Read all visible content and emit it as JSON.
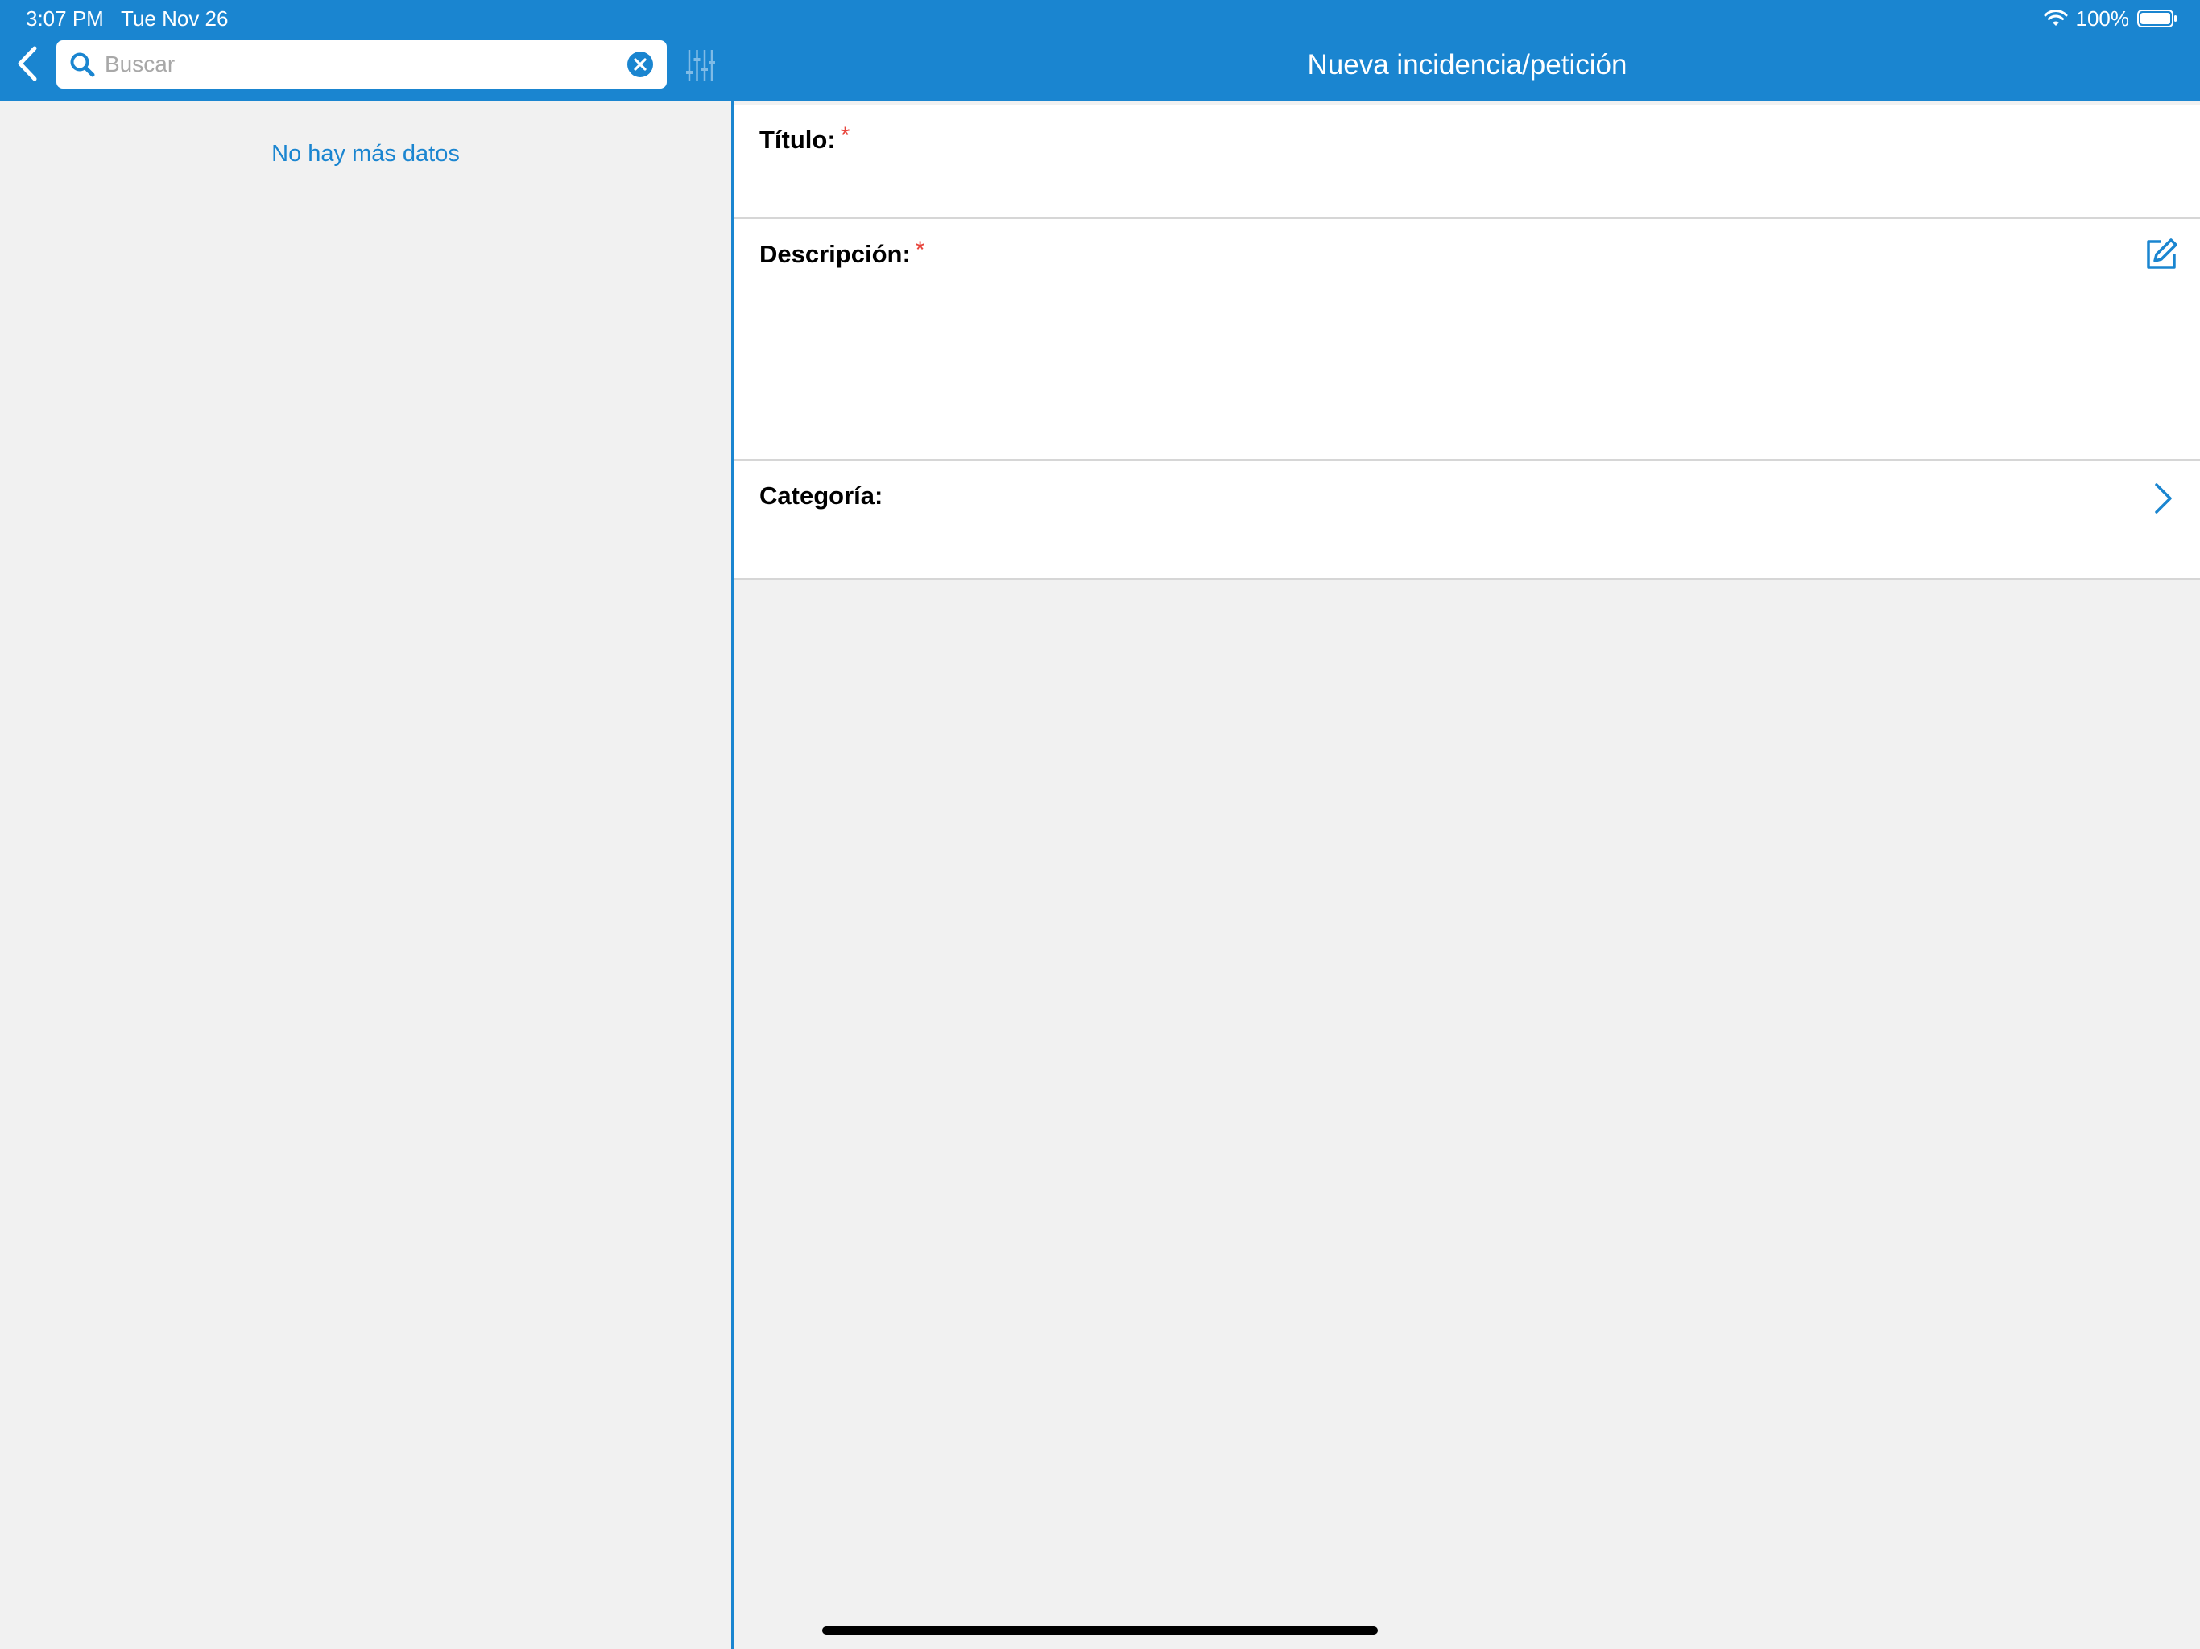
{
  "status_bar": {
    "time": "3:07 PM",
    "date": "Tue Nov 26",
    "battery_percent": "100%",
    "wifi_icon": "wifi-icon",
    "battery_icon": "battery-full-icon"
  },
  "nav": {
    "title": "Nueva incidencia/petición",
    "back_icon": "chevron-left-icon",
    "filter_icon": "sliders-icon"
  },
  "search": {
    "placeholder": "Buscar",
    "value": "",
    "search_icon": "magnifier-icon",
    "clear_icon": "clear-circle-icon"
  },
  "list": {
    "empty_message": "No hay más datos"
  },
  "form": {
    "titulo": {
      "label": "Título:",
      "required_mark": "*",
      "value": ""
    },
    "descripcion": {
      "label": "Descripción:",
      "required_mark": "*",
      "value": "",
      "edit_icon": "edit-icon"
    },
    "categoria": {
      "label": "Categoría:",
      "value": "",
      "chevron_icon": "chevron-right-icon"
    }
  },
  "colors": {
    "accent": "#1a85d0",
    "required": "#e8453c",
    "background": "#f1f1f1",
    "surface": "#ffffff",
    "separator": "#d6d6d6"
  }
}
